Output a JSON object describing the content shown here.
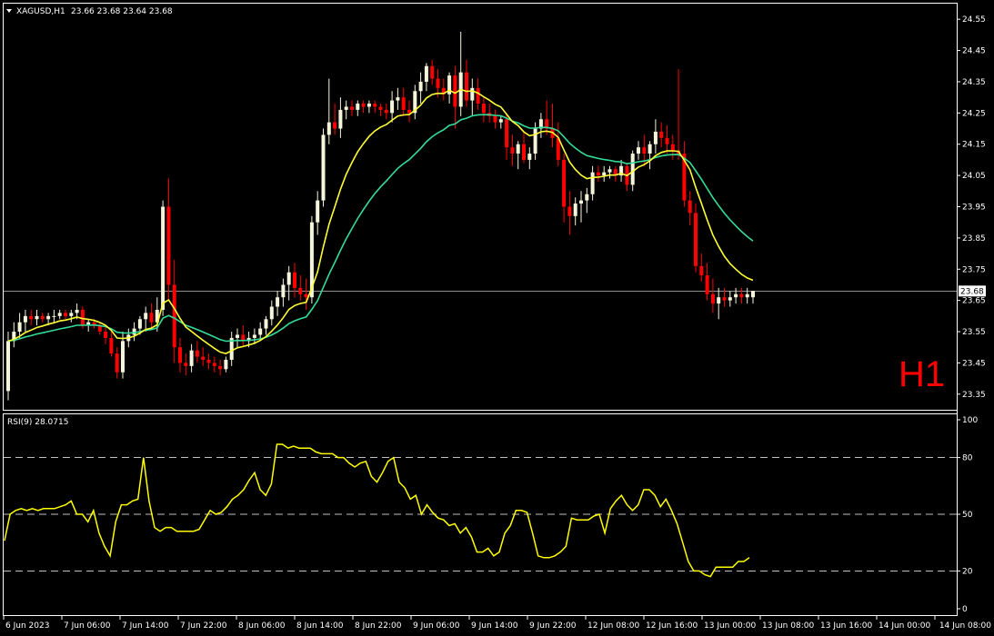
{
  "colors": {
    "background": "#000000",
    "frame": "#ffffff",
    "bull_candle": "#f5f5dc",
    "bear_candle": "#ff0000",
    "ma_fast": "#ffff33",
    "ma_slow": "#33dd99",
    "rsi_line": "#ffff00",
    "price_line": "#c0c0c0",
    "h1_label": "#ff0000"
  },
  "header": {
    "symbol": "XAGUSD,H1",
    "ohlc": "23.66 23.68 23.64 23.68"
  },
  "timeframe_label": "H1",
  "current_price": "23.68",
  "rsi_header": "RSI(9) 28.0715",
  "chart_data": [
    {
      "type": "candlestick",
      "title": "XAGUSD,H1",
      "ylim": [
        23.3,
        24.6
      ],
      "y_ticks": [
        "24.55",
        "24.45",
        "24.35",
        "24.25",
        "24.15",
        "24.05",
        "23.95",
        "23.85",
        "23.75",
        "23.65",
        "23.55",
        "23.45",
        "23.35"
      ],
      "x_ticks": [
        "6 Jun 2023",
        "7 Jun 06:00",
        "7 Jun 14:00",
        "7 Jun 22:00",
        "8 Jun 06:00",
        "8 Jun 14:00",
        "8 Jun 22:00",
        "9 Jun 06:00",
        "9 Jun 14:00",
        "9 Jun 22:00",
        "12 Jun 08:00",
        "12 Jun 16:00",
        "13 Jun 00:00",
        "13 Jun 08:00",
        "13 Jun 16:00",
        "14 Jun 00:00",
        "14 Jun 08:00"
      ],
      "series": [
        {
          "kind": "candles",
          "ohlc": [
            [
              23.36,
              23.55,
              23.33,
              23.52
            ],
            [
              23.52,
              23.58,
              23.5,
              23.55
            ],
            [
              23.55,
              23.61,
              23.53,
              23.58
            ],
            [
              23.58,
              23.62,
              23.55,
              23.6
            ],
            [
              23.6,
              23.62,
              23.57,
              23.59
            ],
            [
              23.59,
              23.62,
              23.57,
              23.6
            ],
            [
              23.6,
              23.61,
              23.58,
              23.59
            ],
            [
              23.59,
              23.61,
              23.57,
              23.6
            ],
            [
              23.6,
              23.62,
              23.58,
              23.6
            ],
            [
              23.6,
              23.62,
              23.59,
              23.61
            ],
            [
              23.61,
              23.62,
              23.59,
              23.6
            ],
            [
              23.6,
              23.62,
              23.58,
              23.61
            ],
            [
              23.61,
              23.64,
              23.59,
              23.62
            ],
            [
              23.62,
              23.63,
              23.56,
              23.57
            ],
            [
              23.57,
              23.59,
              23.55,
              23.58
            ],
            [
              23.58,
              23.59,
              23.56,
              23.57
            ],
            [
              23.57,
              23.58,
              23.54,
              23.55
            ],
            [
              23.55,
              23.57,
              23.51,
              23.53
            ],
            [
              23.53,
              23.55,
              23.47,
              23.48
            ],
            [
              23.48,
              23.5,
              23.4,
              23.42
            ],
            [
              23.42,
              23.55,
              23.4,
              23.52
            ],
            [
              23.52,
              23.56,
              23.5,
              23.54
            ],
            [
              23.54,
              23.58,
              23.52,
              23.56
            ],
            [
              23.56,
              23.6,
              23.54,
              23.59
            ],
            [
              23.59,
              23.63,
              23.55,
              23.61
            ],
            [
              23.61,
              23.64,
              23.56,
              23.58
            ],
            [
              23.58,
              23.66,
              23.55,
              23.62
            ],
            [
              23.62,
              23.97,
              23.6,
              23.95
            ],
            [
              23.95,
              24.04,
              23.65,
              23.7
            ],
            [
              23.7,
              23.78,
              23.45,
              23.5
            ],
            [
              23.5,
              23.53,
              23.42,
              23.45
            ],
            [
              23.45,
              23.48,
              23.41,
              23.44
            ],
            [
              23.44,
              23.51,
              23.42,
              23.49
            ],
            [
              23.49,
              23.52,
              23.45,
              23.47
            ],
            [
              23.47,
              23.5,
              23.44,
              23.46
            ],
            [
              23.46,
              23.48,
              23.43,
              23.45
            ],
            [
              23.45,
              23.47,
              23.42,
              23.44
            ],
            [
              23.44,
              23.46,
              23.41,
              23.43
            ],
            [
              23.43,
              23.47,
              23.42,
              23.46
            ],
            [
              23.46,
              23.55,
              23.44,
              23.53
            ],
            [
              23.53,
              23.56,
              23.5,
              23.54
            ],
            [
              23.54,
              23.57,
              23.5,
              23.52
            ],
            [
              23.52,
              23.55,
              23.5,
              23.53
            ],
            [
              23.53,
              23.56,
              23.51,
              23.54
            ],
            [
              23.54,
              23.58,
              23.52,
              23.56
            ],
            [
              23.56,
              23.6,
              23.54,
              23.59
            ],
            [
              23.59,
              23.65,
              23.57,
              23.63
            ],
            [
              23.63,
              23.68,
              23.6,
              23.66
            ],
            [
              23.66,
              23.72,
              23.63,
              23.7
            ],
            [
              23.7,
              23.76,
              23.65,
              23.74
            ],
            [
              23.74,
              23.77,
              23.66,
              23.69
            ],
            [
              23.69,
              23.73,
              23.65,
              23.67
            ],
            [
              23.67,
              23.72,
              23.62,
              23.66
            ],
            [
              23.66,
              23.92,
              23.64,
              23.9
            ],
            [
              23.9,
              24.0,
              23.86,
              23.97
            ],
            [
              23.97,
              24.2,
              23.95,
              24.18
            ],
            [
              24.18,
              24.36,
              24.15,
              24.22
            ],
            [
              24.22,
              24.28,
              24.18,
              24.2
            ],
            [
              24.2,
              24.3,
              24.17,
              24.26
            ],
            [
              24.26,
              24.29,
              24.23,
              24.27
            ],
            [
              24.27,
              24.29,
              24.24,
              24.26
            ],
            [
              24.26,
              24.29,
              24.24,
              24.28
            ],
            [
              24.28,
              24.29,
              24.25,
              24.27
            ],
            [
              24.27,
              24.29,
              24.25,
              24.28
            ],
            [
              24.28,
              24.29,
              24.25,
              24.27
            ],
            [
              24.27,
              24.28,
              24.24,
              24.26
            ],
            [
              24.26,
              24.28,
              24.23,
              24.25
            ],
            [
              24.25,
              24.32,
              24.22,
              24.29
            ],
            [
              24.29,
              24.33,
              24.26,
              24.3
            ],
            [
              24.3,
              24.33,
              24.24,
              24.26
            ],
            [
              24.26,
              24.29,
              24.22,
              24.25
            ],
            [
              24.25,
              24.34,
              24.23,
              24.32
            ],
            [
              24.32,
              24.38,
              24.28,
              24.35
            ],
            [
              24.35,
              24.41,
              24.32,
              24.4
            ],
            [
              24.4,
              24.42,
              24.34,
              24.36
            ],
            [
              24.36,
              24.39,
              24.3,
              24.33
            ],
            [
              24.33,
              24.36,
              24.29,
              24.31
            ],
            [
              24.31,
              24.38,
              24.28,
              24.37
            ],
            [
              24.37,
              24.4,
              24.2,
              24.27
            ],
            [
              24.27,
              24.51,
              24.24,
              24.38
            ],
            [
              24.38,
              24.42,
              24.27,
              24.29
            ],
            [
              24.29,
              24.36,
              24.24,
              24.33
            ],
            [
              24.33,
              24.36,
              24.26,
              24.28
            ],
            [
              24.28,
              24.3,
              24.22,
              24.25
            ],
            [
              24.25,
              24.28,
              24.22,
              24.24
            ],
            [
              24.24,
              24.26,
              24.2,
              24.22
            ],
            [
              24.22,
              24.24,
              24.2,
              24.23
            ],
            [
              24.23,
              24.25,
              24.1,
              24.14
            ],
            [
              24.14,
              24.18,
              24.08,
              24.12
            ],
            [
              24.12,
              24.16,
              24.07,
              24.15
            ],
            [
              24.15,
              24.19,
              24.09,
              24.1
            ],
            [
              24.1,
              24.14,
              24.07,
              24.12
            ],
            [
              24.12,
              24.22,
              24.1,
              24.2
            ],
            [
              24.2,
              24.25,
              24.17,
              24.23
            ],
            [
              24.23,
              24.29,
              24.18,
              24.2
            ],
            [
              24.2,
              24.28,
              24.14,
              24.17
            ],
            [
              24.17,
              24.22,
              24.08,
              24.1
            ],
            [
              24.1,
              24.12,
              23.9,
              23.95
            ],
            [
              23.95,
              24.0,
              23.86,
              23.92
            ],
            [
              23.92,
              23.98,
              23.89,
              23.96
            ],
            [
              23.96,
              24.0,
              23.9,
              23.97
            ],
            [
              23.97,
              24.01,
              23.93,
              23.99
            ],
            [
              23.99,
              24.08,
              23.97,
              24.06
            ],
            [
              24.06,
              24.08,
              24.03,
              24.05
            ],
            [
              24.05,
              24.08,
              24.03,
              24.06
            ],
            [
              24.06,
              24.08,
              24.04,
              24.07
            ],
            [
              24.07,
              24.08,
              24.03,
              24.05
            ],
            [
              24.05,
              24.1,
              24.03,
              24.08
            ],
            [
              24.08,
              24.09,
              24.0,
              24.02
            ],
            [
              24.02,
              24.13,
              24.0,
              24.12
            ],
            [
              24.12,
              24.16,
              24.1,
              24.14
            ],
            [
              24.14,
              24.18,
              24.08,
              24.12
            ],
            [
              24.12,
              24.16,
              24.07,
              24.15
            ],
            [
              24.15,
              24.23,
              24.12,
              24.19
            ],
            [
              24.19,
              24.22,
              24.14,
              24.17
            ],
            [
              24.17,
              24.21,
              24.12,
              24.15
            ],
            [
              24.15,
              24.18,
              24.1,
              24.13
            ],
            [
              24.13,
              24.39,
              24.1,
              24.12
            ],
            [
              24.12,
              24.16,
              23.95,
              23.97
            ],
            [
              23.97,
              24.0,
              23.89,
              23.93
            ],
            [
              23.93,
              23.96,
              23.74,
              23.76
            ],
            [
              23.76,
              23.8,
              23.71,
              23.73
            ],
            [
              23.73,
              23.77,
              23.65,
              23.67
            ],
            [
              23.67,
              23.72,
              23.61,
              23.64
            ],
            [
              23.64,
              23.69,
              23.59,
              23.66
            ],
            [
              23.66,
              23.69,
              23.63,
              23.65
            ],
            [
              23.65,
              23.68,
              23.63,
              23.66
            ],
            [
              23.66,
              23.69,
              23.64,
              23.67
            ],
            [
              23.67,
              23.69,
              23.64,
              23.66
            ],
            [
              23.66,
              23.69,
              23.64,
              23.67
            ],
            [
              23.66,
              23.68,
              23.64,
              23.68
            ]
          ]
        },
        {
          "kind": "line",
          "role": "ma_fast"
        },
        {
          "kind": "line",
          "role": "ma_slow"
        }
      ]
    },
    {
      "type": "line",
      "title": "RSI(9) 28.0715",
      "ylim": [
        0,
        100
      ],
      "y_ticks": [
        "100",
        "80",
        "50",
        "20",
        "0"
      ],
      "levels": [
        80,
        50,
        20
      ],
      "values": [
        36,
        50,
        52,
        53,
        52,
        53,
        52,
        53,
        53,
        53,
        54,
        55,
        57,
        50,
        50,
        46,
        52,
        40,
        33,
        28,
        46,
        55,
        55,
        57,
        58,
        80,
        57,
        43,
        41,
        43,
        43,
        41,
        41,
        41,
        41,
        42,
        47,
        52,
        50,
        51,
        54,
        58,
        60,
        63,
        68,
        72,
        63,
        60,
        66,
        87,
        87,
        85,
        86,
        85,
        85,
        85,
        83,
        82,
        82,
        82,
        80,
        80,
        77,
        75,
        77,
        78,
        70,
        67,
        72,
        78,
        80,
        67,
        64,
        58,
        60,
        50,
        55,
        51,
        48,
        47,
        44,
        45,
        40,
        43,
        38,
        30,
        30,
        32,
        28,
        30,
        40,
        44,
        52,
        52,
        51,
        40,
        28,
        27,
        27,
        28,
        30,
        33,
        48,
        47,
        47,
        47,
        49,
        50,
        40,
        53,
        57,
        60,
        55,
        52,
        55,
        63,
        63,
        60,
        54,
        58,
        52,
        45,
        35,
        25,
        20,
        20,
        18,
        17,
        22,
        22,
        22,
        22,
        25,
        25,
        27
      ]
    }
  ]
}
